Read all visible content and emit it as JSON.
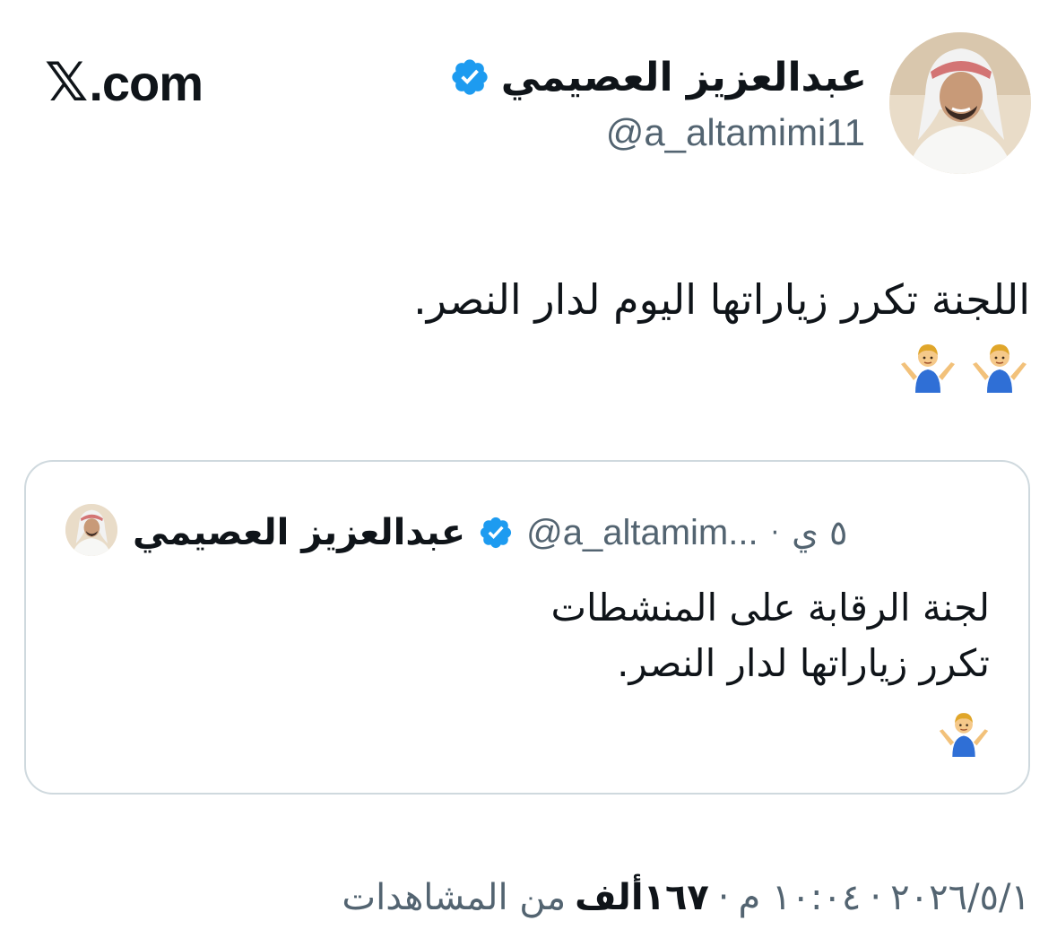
{
  "brand": {
    "logo_text": ".com",
    "logo_mark": "𝕏"
  },
  "author": {
    "name": "عبدالعزيز العصيمي",
    "handle": "@a_altamimi11",
    "verified": true
  },
  "tweet": {
    "text": "اللجنة تكرر زياراتها اليوم لدار النصر.",
    "emojis": [
      "man-shrugging-icon",
      "man-shrugging-icon"
    ]
  },
  "quoted_tweet": {
    "author_name": "عبدالعزيز العصيمي",
    "handle": "@a_altamim...",
    "separator": "·",
    "time": "٥ ي",
    "verified": true,
    "lines": [
      "لجنة الرقابة على المنشطات",
      "تكرر زياراتها لدار النصر."
    ],
    "emoji": "man-shrugging-icon"
  },
  "footer": {
    "date": "٢٠٢٦/٥/١",
    "time": "١٠:٠٤ م",
    "separator": "·",
    "views_count": "١٦٧ألف",
    "views_label": "من المشاهدات"
  },
  "colors": {
    "text": "#0f1419",
    "secondary": "#536471",
    "verified_blue": "#1d9bf0",
    "card_border": "#cfd9de"
  }
}
